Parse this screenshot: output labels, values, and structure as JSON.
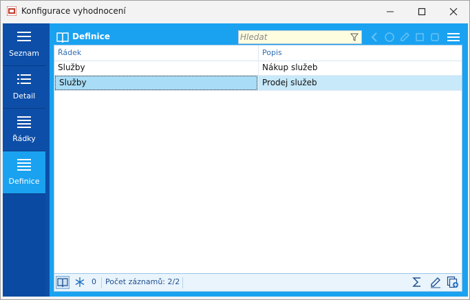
{
  "window": {
    "title": "Konfigurace vyhodnocení"
  },
  "sidebar": {
    "items": [
      {
        "label": "Seznam",
        "active": false
      },
      {
        "label": "Detail",
        "active": false
      },
      {
        "label": "Řádky",
        "active": false
      },
      {
        "label": "Definice",
        "active": true
      }
    ]
  },
  "panel": {
    "title": "Definice",
    "search_placeholder": "Hledat",
    "search_value": ""
  },
  "grid": {
    "columns": [
      "Řádek",
      "Popis"
    ],
    "rows": [
      {
        "radek": "Služby",
        "popis": "Nákup služeb",
        "selected": false
      },
      {
        "radek": "Služby",
        "popis": "Prodej služeb",
        "selected": true
      }
    ]
  },
  "status": {
    "frozen_count": "0",
    "record_count": "Počet záznamů: 2/2"
  },
  "colors": {
    "accent": "#1aa2f0",
    "sidebar": "#0d4ea8",
    "selected_row": "#c7e9fa",
    "header_text": "#2f6db0"
  },
  "icons": [
    "app-icon",
    "minimize-icon",
    "maximize-icon",
    "close-icon",
    "list-icon",
    "book-icon",
    "filter-icon",
    "hamburger-menu-icon",
    "snowflake-icon",
    "sum-icon",
    "edit-icon",
    "add-record-icon"
  ]
}
